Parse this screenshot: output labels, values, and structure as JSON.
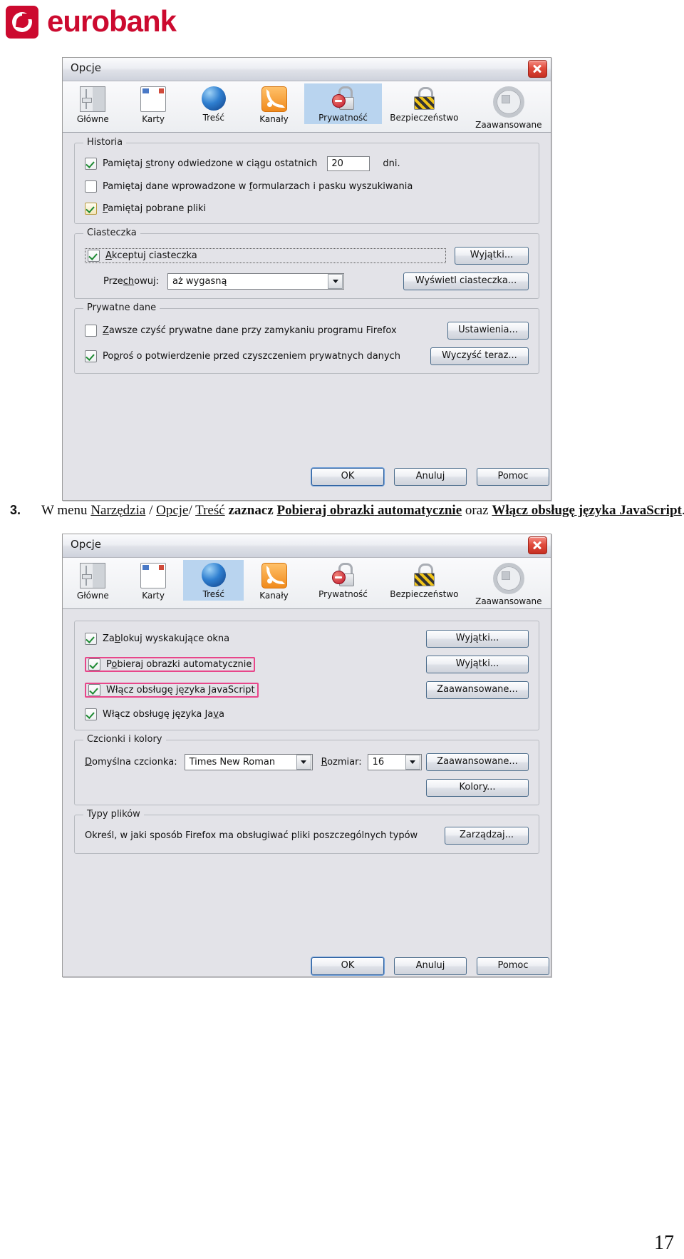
{
  "brand": {
    "name": "eurobank",
    "color": "#cc0a2f",
    "logo_icon": "eurobank-e-logo"
  },
  "page_number": "17",
  "instruction": {
    "number": "3.",
    "part1": "W menu ",
    "tool_menu": "Narzędzia",
    "sep1": " / ",
    "options_menu": "Opcje",
    "sep2": "/ ",
    "content_tab": "Treść",
    "verb": " zaznacz ",
    "option1": "Pobieraj obrazki",
    "option1b": " automatycznie",
    "conj": " oraz ",
    "option2": "Włącz obsługę języka JavaScript",
    "period": "."
  },
  "dialog_privacy": {
    "title": "Opcje",
    "close_icon": "close-icon",
    "tabs": [
      {
        "label": "Główne",
        "icon": "sliders-icon",
        "selected": false
      },
      {
        "label": "Karty",
        "icon": "tabs-icon",
        "selected": false
      },
      {
        "label": "Treść",
        "icon": "globe-icon",
        "selected": false
      },
      {
        "label": "Kanały",
        "icon": "rss-feed-icon",
        "selected": false
      },
      {
        "label": "Prywatność",
        "icon": "open-padlock-icon",
        "selected": true
      },
      {
        "label": "Bezpieczeństwo",
        "icon": "padlock-icon",
        "selected": false
      },
      {
        "label": "Zaawansowane",
        "icon": "gear-icon",
        "selected": false
      }
    ],
    "history": {
      "group_label": "Historia",
      "remember_pages": {
        "label_a": "Pamiętaj ",
        "label_u": "s",
        "label_b": "trony odwiedzone w ciągu ostatnich",
        "checked": true
      },
      "days_value": "20",
      "days_suffix": "dni.",
      "remember_forms": {
        "label_a": "Pamiętaj dane wprowadzone w ",
        "label_u": "f",
        "label_b": "ormularzach i pasku wyszukiwania",
        "checked": false
      },
      "remember_downloads": {
        "label_a": "",
        "label_u": "P",
        "label_b": "amiętaj pobrane pliki",
        "checked": true
      }
    },
    "cookies": {
      "group_label": "Ciasteczka",
      "accept": {
        "label_a": "",
        "label_u": "A",
        "label_b": "kceptuj ciasteczka",
        "checked": true
      },
      "exceptions_button": "Wyjątki...",
      "keep_label_a": "Prze",
      "keep_label_u": "ch",
      "keep_label_b": "owuj:",
      "keep_value": "aż wygasną",
      "show_cookies_button": "Wyświetl ciasteczka..."
    },
    "private_data": {
      "group_label": "Prywatne dane",
      "always_clear": {
        "label_a": "",
        "label_u": "Z",
        "label_b": "awsze czyść prywatne dane przy zamykaniu programu Firefox",
        "checked": false
      },
      "settings_button": "Ustawienia...",
      "ask_confirm": {
        "label_a": "Po",
        "label_u": "p",
        "label_b": "roś o potwierdzenie przed czyszczeniem prywatnych danych",
        "checked": true
      },
      "clear_now_button": "Wyczyść teraz..."
    },
    "footer": {
      "ok": "OK",
      "cancel": "Anuluj",
      "help": "Pomoc"
    }
  },
  "dialog_content": {
    "title": "Opcje",
    "close_icon": "close-icon",
    "tabs": [
      {
        "label": "Główne",
        "icon": "sliders-icon",
        "selected": false
      },
      {
        "label": "Karty",
        "icon": "tabs-icon",
        "selected": false
      },
      {
        "label": "Treść",
        "icon": "globe-icon",
        "selected": true
      },
      {
        "label": "Kanały",
        "icon": "rss-feed-icon",
        "selected": false
      },
      {
        "label": "Prywatność",
        "icon": "open-padlock-icon",
        "selected": false
      },
      {
        "label": "Bezpieczeństwo",
        "icon": "padlock-icon",
        "selected": false
      },
      {
        "label": "Zaawansowane",
        "icon": "gear-icon",
        "selected": false
      }
    ],
    "options": {
      "block_popups": {
        "label_a": "Za",
        "label_u": "b",
        "label_b": "lokuj wyskakujące okna",
        "checked": true,
        "highlighted": false
      },
      "load_images": {
        "label_a": "P",
        "label_u": "o",
        "label_b": "bieraj obrazki automatycznie",
        "checked": true,
        "highlighted": true
      },
      "enable_javascript": {
        "label_a": "Włącz obsługę języka ",
        "label_u": "J",
        "label_b": "avaScript",
        "checked": true,
        "highlighted": true
      },
      "enable_java": {
        "label_a": "Włącz obsługę języka Ja",
        "label_u": "v",
        "label_b": "a",
        "checked": true,
        "highlighted": false
      },
      "exceptions_button_1": "Wyjątki...",
      "exceptions_button_2": "Wyjątki...",
      "advanced_button": "Zaawansowane..."
    },
    "fonts": {
      "group_label": "Czcionki i kolory",
      "default_font_label_a": "",
      "default_font_label_u": "D",
      "default_font_label_b": "omyślna czcionka:",
      "default_font_value": "Times New Roman",
      "size_label_a": "",
      "size_label_u": "R",
      "size_label_b": "ozmiar:",
      "size_value": "16",
      "advanced_button": "Zaawansowane...",
      "colors_button": "Kolory..."
    },
    "file_types": {
      "group_label": "Typy plików",
      "description": "Określ, w jaki sposób Firefox ma obsługiwać pliki poszczególnych typów",
      "manage_button": "Zarządzaj..."
    },
    "footer": {
      "ok": "OK",
      "cancel": "Anuluj",
      "help": "Pomoc"
    }
  },
  "highlight_color": "#e8468a"
}
